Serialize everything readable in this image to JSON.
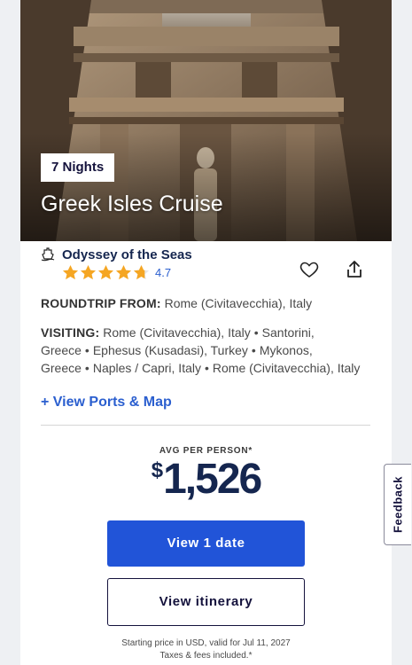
{
  "card": {
    "nights_badge": "7 Nights",
    "title": "Greek Isles Cruise",
    "ship_name": "Odyssey of the Seas",
    "rating": "4.7",
    "rating_stars": 4.7,
    "roundtrip_label": "ROUNDTRIP FROM:",
    "roundtrip_value": "Rome (Civitavecchia), Italy",
    "visiting_label": "VISITING:",
    "ports": [
      "Rome (Civitavecchia), Italy",
      "Santorini, Greece",
      "Ephesus (Kusadasi), Turkey",
      "Mykonos, Greece",
      "Naples / Capri, Italy",
      "Rome (Civitavecchia), Italy"
    ],
    "view_ports_link": "+ View Ports & Map",
    "avg_label": "AVG PER PERSON*",
    "price_currency": "$",
    "price_amount": "1,526",
    "view_dates_button": "View 1 date",
    "view_itinerary_button": "View itinerary",
    "footnote_line1": "Starting price in USD, valid for Jul 11, 2027",
    "footnote_line2": "Taxes & fees included.*"
  },
  "feedback_tab": "Feedback",
  "colors": {
    "accent_blue": "#2154d8",
    "link_blue": "#2b5fcf",
    "navy": "#15264f",
    "star_orange": "#f5a623"
  },
  "icons": {
    "ship": "ship-icon",
    "heart": "heart-icon",
    "share": "share-icon",
    "star": "star-icon"
  }
}
